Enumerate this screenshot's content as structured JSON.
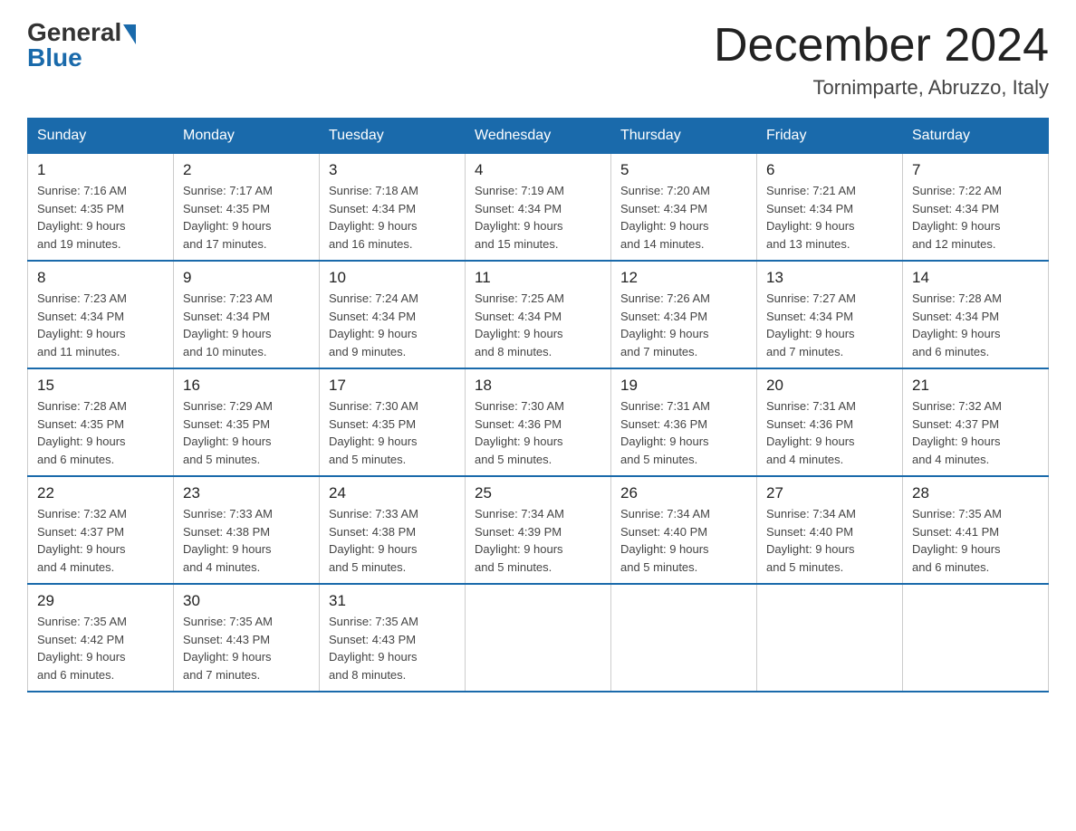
{
  "logo": {
    "general": "General",
    "blue": "Blue"
  },
  "title": "December 2024",
  "location": "Tornimparte, Abruzzo, Italy",
  "weekdays": [
    "Sunday",
    "Monday",
    "Tuesday",
    "Wednesday",
    "Thursday",
    "Friday",
    "Saturday"
  ],
  "weeks": [
    [
      {
        "day": "1",
        "sunrise": "7:16 AM",
        "sunset": "4:35 PM",
        "daylight": "9 hours and 19 minutes."
      },
      {
        "day": "2",
        "sunrise": "7:17 AM",
        "sunset": "4:35 PM",
        "daylight": "9 hours and 17 minutes."
      },
      {
        "day": "3",
        "sunrise": "7:18 AM",
        "sunset": "4:34 PM",
        "daylight": "9 hours and 16 minutes."
      },
      {
        "day": "4",
        "sunrise": "7:19 AM",
        "sunset": "4:34 PM",
        "daylight": "9 hours and 15 minutes."
      },
      {
        "day": "5",
        "sunrise": "7:20 AM",
        "sunset": "4:34 PM",
        "daylight": "9 hours and 14 minutes."
      },
      {
        "day": "6",
        "sunrise": "7:21 AM",
        "sunset": "4:34 PM",
        "daylight": "9 hours and 13 minutes."
      },
      {
        "day": "7",
        "sunrise": "7:22 AM",
        "sunset": "4:34 PM",
        "daylight": "9 hours and 12 minutes."
      }
    ],
    [
      {
        "day": "8",
        "sunrise": "7:23 AM",
        "sunset": "4:34 PM",
        "daylight": "9 hours and 11 minutes."
      },
      {
        "day": "9",
        "sunrise": "7:23 AM",
        "sunset": "4:34 PM",
        "daylight": "9 hours and 10 minutes."
      },
      {
        "day": "10",
        "sunrise": "7:24 AM",
        "sunset": "4:34 PM",
        "daylight": "9 hours and 9 minutes."
      },
      {
        "day": "11",
        "sunrise": "7:25 AM",
        "sunset": "4:34 PM",
        "daylight": "9 hours and 8 minutes."
      },
      {
        "day": "12",
        "sunrise": "7:26 AM",
        "sunset": "4:34 PM",
        "daylight": "9 hours and 7 minutes."
      },
      {
        "day": "13",
        "sunrise": "7:27 AM",
        "sunset": "4:34 PM",
        "daylight": "9 hours and 7 minutes."
      },
      {
        "day": "14",
        "sunrise": "7:28 AM",
        "sunset": "4:34 PM",
        "daylight": "9 hours and 6 minutes."
      }
    ],
    [
      {
        "day": "15",
        "sunrise": "7:28 AM",
        "sunset": "4:35 PM",
        "daylight": "9 hours and 6 minutes."
      },
      {
        "day": "16",
        "sunrise": "7:29 AM",
        "sunset": "4:35 PM",
        "daylight": "9 hours and 5 minutes."
      },
      {
        "day": "17",
        "sunrise": "7:30 AM",
        "sunset": "4:35 PM",
        "daylight": "9 hours and 5 minutes."
      },
      {
        "day": "18",
        "sunrise": "7:30 AM",
        "sunset": "4:36 PM",
        "daylight": "9 hours and 5 minutes."
      },
      {
        "day": "19",
        "sunrise": "7:31 AM",
        "sunset": "4:36 PM",
        "daylight": "9 hours and 5 minutes."
      },
      {
        "day": "20",
        "sunrise": "7:31 AM",
        "sunset": "4:36 PM",
        "daylight": "9 hours and 4 minutes."
      },
      {
        "day": "21",
        "sunrise": "7:32 AM",
        "sunset": "4:37 PM",
        "daylight": "9 hours and 4 minutes."
      }
    ],
    [
      {
        "day": "22",
        "sunrise": "7:32 AM",
        "sunset": "4:37 PM",
        "daylight": "9 hours and 4 minutes."
      },
      {
        "day": "23",
        "sunrise": "7:33 AM",
        "sunset": "4:38 PM",
        "daylight": "9 hours and 4 minutes."
      },
      {
        "day": "24",
        "sunrise": "7:33 AM",
        "sunset": "4:38 PM",
        "daylight": "9 hours and 5 minutes."
      },
      {
        "day": "25",
        "sunrise": "7:34 AM",
        "sunset": "4:39 PM",
        "daylight": "9 hours and 5 minutes."
      },
      {
        "day": "26",
        "sunrise": "7:34 AM",
        "sunset": "4:40 PM",
        "daylight": "9 hours and 5 minutes."
      },
      {
        "day": "27",
        "sunrise": "7:34 AM",
        "sunset": "4:40 PM",
        "daylight": "9 hours and 5 minutes."
      },
      {
        "day": "28",
        "sunrise": "7:35 AM",
        "sunset": "4:41 PM",
        "daylight": "9 hours and 6 minutes."
      }
    ],
    [
      {
        "day": "29",
        "sunrise": "7:35 AM",
        "sunset": "4:42 PM",
        "daylight": "9 hours and 6 minutes."
      },
      {
        "day": "30",
        "sunrise": "7:35 AM",
        "sunset": "4:43 PM",
        "daylight": "9 hours and 7 minutes."
      },
      {
        "day": "31",
        "sunrise": "7:35 AM",
        "sunset": "4:43 PM",
        "daylight": "9 hours and 8 minutes."
      },
      null,
      null,
      null,
      null
    ]
  ],
  "labels": {
    "sunrise": "Sunrise:",
    "sunset": "Sunset:",
    "daylight": "Daylight:"
  }
}
